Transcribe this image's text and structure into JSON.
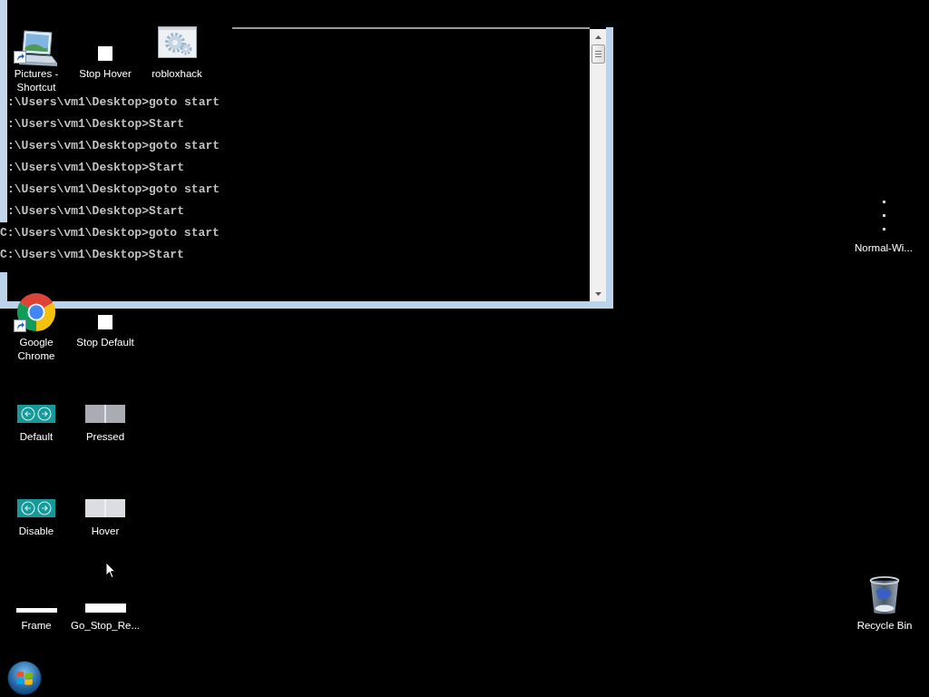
{
  "console_window": {
    "lines": [
      {
        "text": ":\\Users\\vm1\\Desktop>goto start",
        "covered": true
      },
      {
        "text": ":\\Users\\vm1\\Desktop>Start",
        "covered": true
      },
      {
        "text": ":\\Users\\vm1\\Desktop>goto start",
        "covered": true
      },
      {
        "text": ":\\Users\\vm1\\Desktop>Start",
        "covered": true
      },
      {
        "text": ":\\Users\\vm1\\Desktop>goto start",
        "covered": true
      },
      {
        "text": ":\\Users\\vm1\\Desktop>Start",
        "covered": true
      },
      {
        "text": "C:\\Users\\vm1\\Desktop>goto start",
        "covered": false
      },
      {
        "text": "C:\\Users\\vm1\\Desktop>Start",
        "covered": false
      }
    ]
  },
  "desktop_icons": [
    {
      "label": "Pictures - Shortcut",
      "kind": "laptop",
      "shortcut": true
    },
    {
      "label": "Stop Hover",
      "kind": "square",
      "shortcut": false
    },
    {
      "label": "robloxhack",
      "kind": "gear-window",
      "shortcut": false
    },
    {
      "label": "Normal-Wi...",
      "kind": "dots",
      "shortcut": false
    },
    {
      "label": "Google Chrome",
      "kind": "circle-logo",
      "shortcut": true
    },
    {
      "label": "Stop Default",
      "kind": "square",
      "shortcut": false
    },
    {
      "label": "Default",
      "kind": "arrow-tile",
      "shortcut": false
    },
    {
      "label": "Pressed",
      "kind": "split-tile",
      "color": "#a9acb3",
      "shortcut": false
    },
    {
      "label": "Disable",
      "kind": "arrow-tile",
      "shortcut": false
    },
    {
      "label": "Hover",
      "kind": "split-tile",
      "color": "#dcdde1",
      "shortcut": false
    },
    {
      "label": "Frame",
      "kind": "line",
      "shortcut": false
    },
    {
      "label": "Go_Stop_Re...",
      "kind": "bar",
      "shortcut": false
    },
    {
      "label": "Recycle Bin",
      "kind": "trash",
      "shortcut": false
    }
  ]
}
